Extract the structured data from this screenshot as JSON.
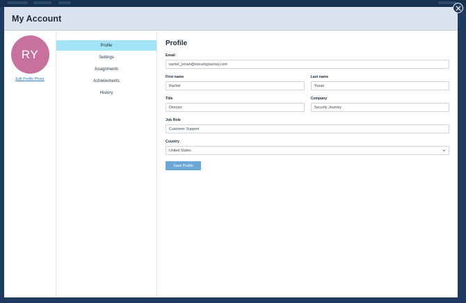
{
  "modal": {
    "title": "My Account",
    "close_icon": "close-icon"
  },
  "user": {
    "initials": "RY",
    "avatar_color": "#c8719e",
    "edit_photo_label": "Edit Profile Photo"
  },
  "nav": {
    "items": [
      {
        "label": "Profile",
        "active": true
      },
      {
        "label": "Settings",
        "active": false
      },
      {
        "label": "Assignments",
        "active": false
      },
      {
        "label": "Achievements",
        "active": false
      },
      {
        "label": "History",
        "active": false
      }
    ]
  },
  "profile": {
    "title": "Profile",
    "email": {
      "label": "Email",
      "value": "rachel_yonan@securityjourney.com"
    },
    "first_name": {
      "label": "First name",
      "value": "Rachel"
    },
    "last_name": {
      "label": "Last name",
      "value": "Yonan"
    },
    "title_field": {
      "label": "Title",
      "value": "Director"
    },
    "company": {
      "label": "Company",
      "value": "Security Journey"
    },
    "job_role": {
      "label": "Job Role",
      "value": "Customer Support"
    },
    "country": {
      "label": "Country",
      "value": "United States",
      "icon": "chevron-down-icon"
    },
    "save_label": "Save Profile"
  },
  "colors": {
    "accent_nav": "#a3e4f7",
    "save_button": "#6aa9d7",
    "backdrop": "#1e3a5f",
    "header": "#dde3ee"
  }
}
